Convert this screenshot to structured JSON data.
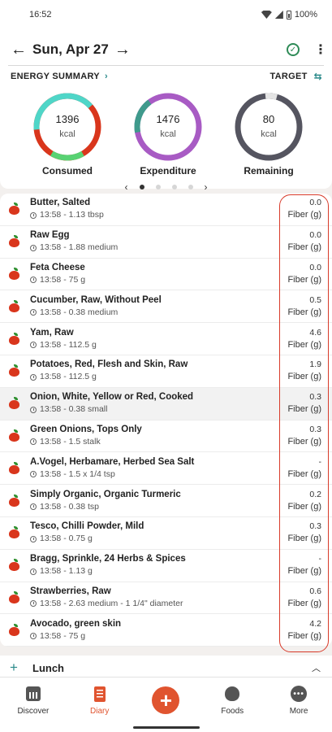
{
  "status_bar": {
    "time": "16:52",
    "battery": "100%"
  },
  "header": {
    "date": "Sun, Apr 27"
  },
  "energy": {
    "summary_label": "ENERGY SUMMARY",
    "target_label": "TARGET",
    "rings": [
      {
        "value": "1396",
        "unit": "kcal",
        "label": "Consumed"
      },
      {
        "value": "1476",
        "unit": "kcal",
        "label": "Expenditure"
      },
      {
        "value": "80",
        "unit": "kcal",
        "label": "Remaining"
      }
    ]
  },
  "foods": [
    {
      "name": "Butter, Salted",
      "meta": "13:58 - 1.13 tbsp",
      "value": "0.0",
      "unit": "Fiber (g)"
    },
    {
      "name": "Raw Egg",
      "meta": "13:58 - 1.88 medium",
      "value": "0.0",
      "unit": "Fiber (g)"
    },
    {
      "name": "Feta Cheese",
      "meta": "13:58 - 75 g",
      "value": "0.0",
      "unit": "Fiber (g)"
    },
    {
      "name": "Cucumber, Raw, Without Peel",
      "meta": "13:58 - 0.38 medium",
      "value": "0.5",
      "unit": "Fiber (g)"
    },
    {
      "name": "Yam, Raw",
      "meta": "13:58 - 112.5 g",
      "value": "4.6",
      "unit": "Fiber (g)"
    },
    {
      "name": "Potatoes, Red, Flesh and Skin, Raw",
      "meta": "13:58 - 112.5 g",
      "value": "1.9",
      "unit": "Fiber (g)"
    },
    {
      "name": "Onion, White, Yellow or Red, Cooked",
      "meta": "13:58 - 0.38 small",
      "value": "0.3",
      "unit": "Fiber (g)"
    },
    {
      "name": "Green Onions, Tops Only",
      "meta": "13:58 - 1.5 stalk",
      "value": "0.3",
      "unit": "Fiber (g)"
    },
    {
      "name": "A.Vogel, Herbamare, Herbed Sea Salt",
      "meta": "13:58 - 1.5 x 1/4 tsp",
      "value": "-",
      "unit": "Fiber (g)"
    },
    {
      "name": "Simply Organic, Organic Turmeric",
      "meta": "13:58 - 0.38 tsp",
      "value": "0.2",
      "unit": "Fiber (g)"
    },
    {
      "name": "Tesco, Chilli Powder, Mild",
      "meta": "13:58 - 0.75 g",
      "value": "0.3",
      "unit": "Fiber (g)"
    },
    {
      "name": "Bragg, Sprinkle, 24 Herbs & Spices",
      "meta": "13:58 - 1.13 g",
      "value": "-",
      "unit": "Fiber (g)"
    },
    {
      "name": "Strawberries, Raw",
      "meta": "13:58 - 2.63 medium - 1 1/4\" diameter",
      "value": "0.6",
      "unit": "Fiber (g)"
    },
    {
      "name": "Avocado, green skin",
      "meta": "13:58 - 75 g",
      "value": "4.2",
      "unit": "Fiber (g)"
    }
  ],
  "lunch": {
    "title": "Lunch"
  },
  "nav": {
    "discover": "Discover",
    "diary": "Diary",
    "foods": "Foods",
    "more": "More"
  },
  "colors": {
    "accent": "#e0542f",
    "teal": "#2b8a8a",
    "highlight": "#d83a2a",
    "consumed_ring": "#d9361c",
    "expenditure_ring": "#a85bc4",
    "remaining_ring": "#555560"
  }
}
